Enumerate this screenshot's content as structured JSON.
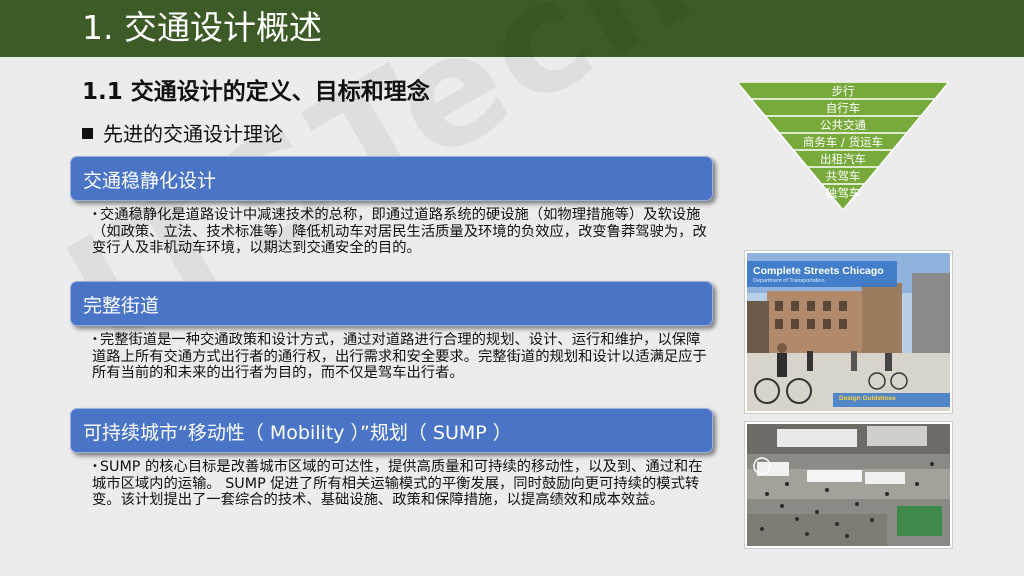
{
  "slide_title": "1. 交通设计概述",
  "section_heading": "1.1  交通设计的定义、目标和理念",
  "subheading": "先进的交通设计理论",
  "watermark": "ITSTech",
  "sections": [
    {
      "title": "交通稳静化设计",
      "body": "交通稳静化是道路设计中减速技术的总称，即通过道路系统的硬设施（如物理措施等）及软设施（如政策、立法、技术标准等）降低机动车对居民生活质量及环境的负效应，改变鲁莽驾驶为，改变行人及非机动车环境，以期达到交通安全的目的。"
    },
    {
      "title": "完整街道",
      "body": "完整街道是一种交通政策和设计方式，通过对道路进行合理的规划、设计、运行和维护，以保障道路上所有交通方式出行者的通行权，出行需求和安全要求。完整街道的规划和设计以适满足应于所有当前的和未来的出行者为目的，而不仅是驾车出行者。"
    },
    {
      "title": "可持续城市“移动性（ Mobility ）”规划（ SUMP ）",
      "body": "SUMP 的核心目标是改善城市区域的可达性，提供高质量和可持续的移动性，以及到、通过和在城市区域内的运输。 SUMP 促进了所有相关运输模式的平衡发展，同时鼓励向更可持续的模式转变。该计划提出了一套综合的技术、基础设施、政策和保障措施，以提高绩效和成本效益。"
    }
  ],
  "pyramid": {
    "levels": [
      "步行",
      "自行车",
      "公共交通",
      "商务车 / 货运车",
      "出租汽车",
      "共驾车",
      "独驾车"
    ],
    "color": "#77aa3a"
  },
  "photo1": {
    "title": "Complete Streets Chicago",
    "subtitle": "Department of Transportation",
    "footer": "Design Guidelines"
  },
  "colors": {
    "title_bar": "#3c5b27",
    "section_bar": "#4a74c6",
    "background": "#ececec"
  }
}
